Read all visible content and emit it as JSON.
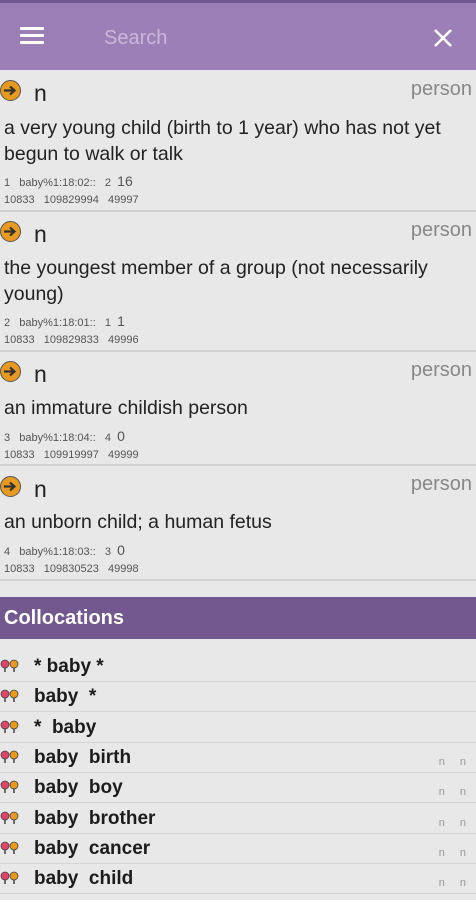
{
  "search": {
    "placeholder": "Search"
  },
  "senses": [
    {
      "pos": "n",
      "domain": "person",
      "gloss": "a very young child (birth to 1 year) who has not yet begun to walk or talk",
      "meta1": [
        "1",
        "baby%1:18:02::",
        "2"
      ],
      "meta_big": "16",
      "meta2": [
        "10833",
        "109829994",
        "49997"
      ]
    },
    {
      "pos": "n",
      "domain": "person",
      "gloss": "the youngest member of a group (not necessarily young)",
      "meta1": [
        "2",
        "baby%1:18:01::",
        "1"
      ],
      "meta_big": "1",
      "meta2": [
        "10833",
        "109829833",
        "49996"
      ]
    },
    {
      "pos": "n",
      "domain": "person",
      "gloss": "an immature childish person",
      "meta1": [
        "3",
        "baby%1:18:04::",
        "4"
      ],
      "meta_big": "0",
      "meta2": [
        "10833",
        "109919997",
        "49999"
      ]
    },
    {
      "pos": "n",
      "domain": "person",
      "gloss": "an unborn child; a human fetus",
      "meta1": [
        "4",
        "baby%1:18:03::",
        "3"
      ],
      "meta_big": "0",
      "meta2": [
        "10833",
        "109830523",
        "49998"
      ]
    }
  ],
  "collocations": {
    "title": "Collocations",
    "items": [
      {
        "text": "* baby *",
        "tags": ""
      },
      {
        "text": "baby  *",
        "tags": ""
      },
      {
        "text": "*  baby",
        "tags": ""
      },
      {
        "text": "baby  birth",
        "tags": "n n"
      },
      {
        "text": "baby  boy",
        "tags": "n n"
      },
      {
        "text": "baby  brother",
        "tags": "n n"
      },
      {
        "text": "baby  cancer",
        "tags": "n n"
      },
      {
        "text": "baby  child",
        "tags": "n n"
      }
    ]
  },
  "colors": {
    "toolbar": "#9b7fb6",
    "section_header": "#72588f",
    "arrow": "#e89a1e"
  }
}
